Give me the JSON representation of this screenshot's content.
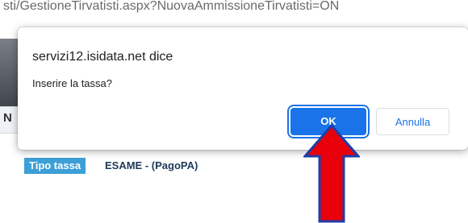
{
  "background": {
    "url_fragment": "sti/GestioneTirvatisti.aspx?NuovaAmmissioneTirvatisti=ON",
    "section_letter": "N",
    "tipo_tassa_label": "Tipo tassa",
    "tipo_tassa_value": "ESAME - (PagoPA)"
  },
  "dialog": {
    "title": "servizi12.isidata.net dice",
    "message": "Inserire la tassa?",
    "ok_label": "OK",
    "cancel_label": "Annulla"
  },
  "annotation": {
    "arrow_color": "#e8000b",
    "arrow_outline": "#1f3ea8"
  }
}
